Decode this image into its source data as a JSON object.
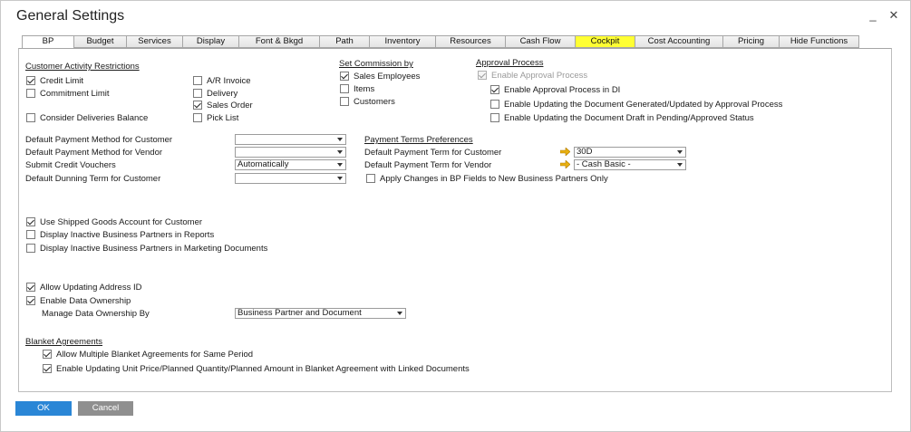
{
  "window": {
    "title": "General Settings"
  },
  "window_controls": {
    "minimize": "_",
    "close": "✕"
  },
  "tabs": [
    {
      "label": "BP"
    },
    {
      "label": "Budget"
    },
    {
      "label": "Services"
    },
    {
      "label": "Display"
    },
    {
      "label": "Font & Bkgd"
    },
    {
      "label": "Path"
    },
    {
      "label": "Inventory"
    },
    {
      "label": "Resources"
    },
    {
      "label": "Cash Flow"
    },
    {
      "label": "Cockpit"
    },
    {
      "label": "Cost Accounting"
    },
    {
      "label": "Pricing"
    },
    {
      "label": "Hide Functions"
    }
  ],
  "colors": {
    "highlight": "#ffff33",
    "ok_button": "#2a86d6",
    "cancel_button": "#8f8f8f",
    "link_arrow": "#e8b010"
  },
  "customer_activity": {
    "heading": "Customer Activity Restrictions",
    "credit_limit": {
      "label": "Credit Limit",
      "checked": true
    },
    "commitment_limit": {
      "label": "Commitment Limit",
      "checked": false
    },
    "consider_deliveries": {
      "label": "Consider Deliveries Balance",
      "checked": false
    },
    "ar_invoice": {
      "label": "A/R Invoice",
      "checked": false
    },
    "delivery": {
      "label": "Delivery",
      "checked": false
    },
    "sales_order": {
      "label": "Sales Order",
      "checked": true
    },
    "pick_list": {
      "label": "Pick List",
      "checked": false
    }
  },
  "commission": {
    "heading": "Set Commission by",
    "sales_employees": {
      "label": "Sales Employees",
      "checked": true
    },
    "items": {
      "label": "Items",
      "checked": false
    },
    "customers": {
      "label": "Customers",
      "checked": false
    }
  },
  "approval": {
    "heading": "Approval Process",
    "enable_approval": {
      "label": "Enable Approval Process",
      "checked": true,
      "disabled": true
    },
    "enable_in_di": {
      "label": "Enable Approval Process in DI",
      "checked": true
    },
    "enable_updating_generated": {
      "label": "Enable Updating the Document Generated/Updated by Approval Process",
      "checked": false
    },
    "enable_updating_draft": {
      "label": "Enable Updating the Document Draft in Pending/Approved Status",
      "checked": false
    }
  },
  "payment_methods": {
    "customer": {
      "label": "Default Payment Method for Customer",
      "value": ""
    },
    "vendor": {
      "label": "Default Payment Method for Vendor",
      "value": ""
    },
    "credit_vouchers": {
      "label": "Submit Credit Vouchers",
      "value": "Automatically"
    },
    "dunning": {
      "label": "Default Dunning Term for Customer",
      "value": ""
    }
  },
  "payment_terms": {
    "heading": "Payment Terms Preferences",
    "customer": {
      "label": "Default Payment Term for Customer",
      "value": "30D"
    },
    "vendor": {
      "label": "Default Payment Term for Vendor",
      "value": "- Cash Basic -"
    },
    "apply_changes": {
      "label": "Apply Changes in BP Fields to New Business Partners Only",
      "checked": false
    }
  },
  "misc": {
    "shipped_goods": {
      "label": "Use Shipped Goods Account for Customer",
      "checked": true
    },
    "inactive_reports": {
      "label": "Display Inactive Business Partners in Reports",
      "checked": false
    },
    "inactive_marketing": {
      "label": "Display Inactive Business Partners in Marketing Documents",
      "checked": false
    },
    "allow_address_id": {
      "label": "Allow Updating Address ID",
      "checked": true
    },
    "data_ownership": {
      "label": "Enable Data Ownership",
      "checked": true
    },
    "manage_ownership": {
      "label": "Manage Data Ownership By",
      "value": "Business Partner and Document"
    }
  },
  "blanket": {
    "heading": "Blanket Agreements",
    "multiple": {
      "label": "Allow Multiple Blanket Agreements for Same Period",
      "checked": true
    },
    "enable_updating": {
      "label": "Enable Updating Unit Price/Planned Quantity/Planned Amount in Blanket Agreement with Linked Documents",
      "checked": true
    }
  },
  "buttons": {
    "ok": "OK",
    "cancel": "Cancel"
  }
}
